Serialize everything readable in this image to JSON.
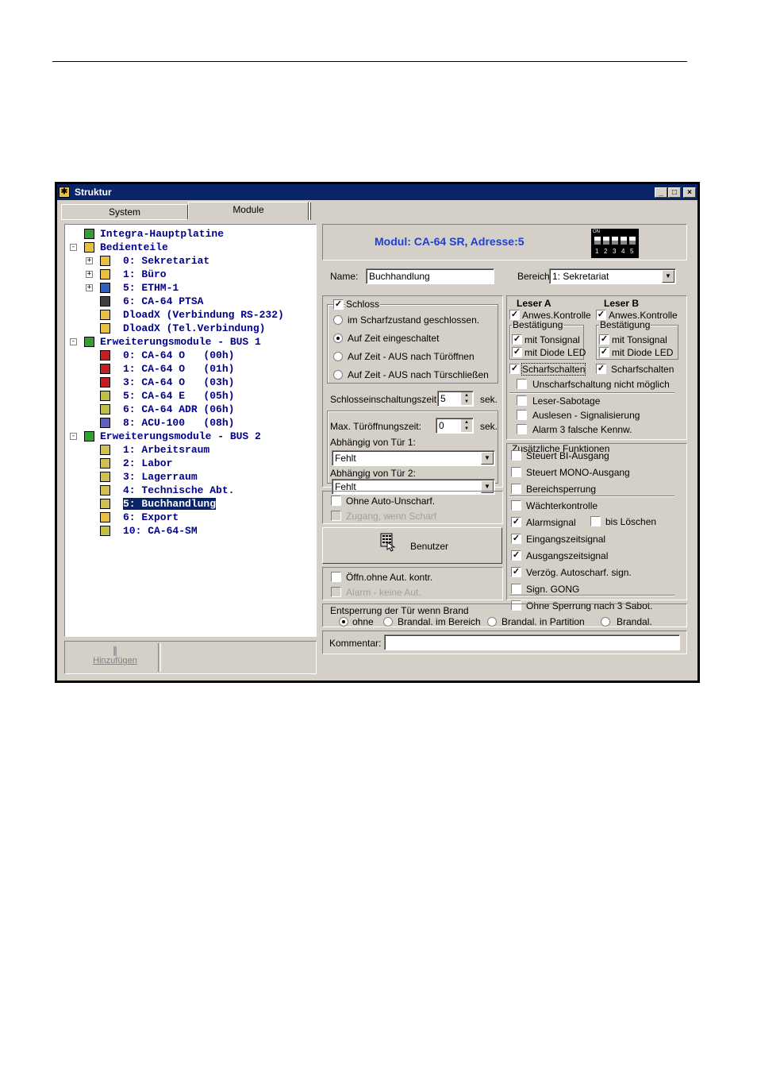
{
  "window": {
    "title": "Struktur",
    "controls": {
      "minimize": "_",
      "maximize": "□",
      "close": "×"
    }
  },
  "tabs": [
    {
      "label": "System",
      "active": false
    },
    {
      "label": "Module",
      "active": true
    }
  ],
  "tree": [
    {
      "label": "Integra-Hauptplatine",
      "icon": "board-icon",
      "expand": ""
    },
    {
      "label": "Bedienteile",
      "icon": "keypad-group-icon",
      "expand": "-"
    },
    {
      "label": "0: Sekretariat",
      "icon": "keypad-icon",
      "expand": "+"
    },
    {
      "label": "1: Büro",
      "icon": "keypad-icon",
      "expand": "+"
    },
    {
      "label": "5: ETHM-1",
      "icon": "ethernet-module-icon",
      "expand": "+"
    },
    {
      "label": "6: CA-64 PTSA",
      "icon": "ptsa-icon",
      "expand": ""
    },
    {
      "label": "DloadX (Verbindung RS-232)",
      "icon": "dloadx-icon",
      "expand": ""
    },
    {
      "label": "DloadX (Tel.Verbindung)",
      "icon": "dloadx-icon",
      "expand": ""
    },
    {
      "label": "Erweiterungsmodule - BUS 1",
      "icon": "bus-icon",
      "expand": "-"
    },
    {
      "label": "0: CA-64 O   (00h)",
      "icon": "output-module-icon",
      "expand": ""
    },
    {
      "label": "1: CA-64 O   (01h)",
      "icon": "output-module-icon",
      "expand": ""
    },
    {
      "label": "3: CA-64 O   (03h)",
      "icon": "output-module-icon",
      "expand": ""
    },
    {
      "label": "5: CA-64 E   (05h)",
      "icon": "expander-icon",
      "expand": ""
    },
    {
      "label": "6: CA-64 ADR (06h)",
      "icon": "expander-icon",
      "expand": ""
    },
    {
      "label": "8: ACU-100   (08h)",
      "icon": "wireless-icon",
      "expand": ""
    },
    {
      "label": "Erweiterungsmodule - BUS 2",
      "icon": "bus-icon",
      "expand": "-"
    },
    {
      "label": "1: Arbeitsraum",
      "icon": "reader-icon",
      "expand": ""
    },
    {
      "label": "2: Labor",
      "icon": "key-reader-icon",
      "expand": ""
    },
    {
      "label": "3: Lagerraum",
      "icon": "reader-icon",
      "expand": ""
    },
    {
      "label": "4: Technische Abt.",
      "icon": "key-reader-icon",
      "expand": ""
    },
    {
      "label": "5: Buchhandlung",
      "icon": "card-reader-icon",
      "expand": "",
      "selected": true
    },
    {
      "label": "6: Export",
      "icon": "door-module-icon",
      "expand": ""
    },
    {
      "label": "10: CA-64-SM",
      "icon": "siren-icon",
      "expand": ""
    }
  ],
  "add_button": {
    "label": "Hinzufügen",
    "underline": "H"
  },
  "header": {
    "module_title": "Modul: CA-64 SR, Adresse:5",
    "dip_on": "ON",
    "dip_numbers": [
      "1",
      "2",
      "3",
      "4",
      "5"
    ],
    "accent": "#1f3fd0"
  },
  "form": {
    "name_label": "Name:",
    "name_value": "Buchhandlung",
    "bereich_label": "Bereich",
    "bereich_value": "1: Sekretariat",
    "schloss_label": "Schloss",
    "schloss_checked": true,
    "schloss_options": [
      {
        "label": "im Scharfzustand geschlossen.",
        "selected": false
      },
      {
        "label": "Auf Zeit eingeschaltet",
        "selected": true
      },
      {
        "label": "Auf Zeit - AUS nach Türöffnen",
        "selected": false
      },
      {
        "label": "Auf Zeit - AUS nach Türschließen",
        "selected": false
      }
    ],
    "schloss_time_label": "Schlosseinschaltungszeit:",
    "schloss_time_value": "5",
    "sek": "sek.",
    "max_open_label": "Max. Türöffnungszeit:",
    "max_open_value": "0",
    "depend1_label": "Abhängig von Tür 1:",
    "depend1_value": "Fehlt",
    "depend2_label": "Abhängig von Tür 2:",
    "depend2_value": "Fehlt",
    "ohne_auto_unscharf": {
      "label": "Ohne Auto-Unscharf.",
      "checked": false
    },
    "zugang_wenn_scharf": {
      "label": "Zugang, wenn Scharf",
      "checked": false,
      "disabled": true
    },
    "benutzer_label": "Benutzer",
    "offn_ohne": {
      "label": "Öffn.ohne Aut. kontr.",
      "checked": false
    },
    "alarm_keine_aut": {
      "label": "Alarm - keine Aut.",
      "checked": false,
      "disabled": true
    },
    "brand_label": "Entsperrung der Tür wenn Brand",
    "brand_options": [
      {
        "label": "ohne",
        "selected": true
      },
      {
        "label": "Brandal. im Bereich",
        "selected": false
      },
      {
        "label": "Brandal. in Partition",
        "selected": false
      },
      {
        "label": "Brandal.",
        "selected": false
      }
    ],
    "kommentar_label": "Kommentar:",
    "kommentar_value": ""
  },
  "leser": {
    "a_title": "Leser A",
    "b_title": "Leser B",
    "a_anwes": {
      "label": "Anwes.Kontrolle",
      "checked": true
    },
    "b_anwes": {
      "label": "Anwes.Kontrolle",
      "checked": true
    },
    "bestaetigung": "Bestätigung",
    "a_tonsignal": {
      "label": "mit Tonsignal",
      "checked": true
    },
    "a_diode": {
      "label": "mit Diode LED",
      "checked": true
    },
    "b_tonsignal": {
      "label": "mit Tonsignal",
      "checked": true
    },
    "b_diode": {
      "label": "mit Diode LED",
      "checked": true
    },
    "a_scharf": {
      "label": "Scharfschalten",
      "checked": true
    },
    "b_scharf": {
      "label": "Scharfschalten",
      "checked": true
    },
    "unscharf_nicht": {
      "label": "Unscharfschaltung nicht möglich",
      "checked": false
    },
    "leser_sabotage": {
      "label": "Leser-Sabotage",
      "checked": false
    },
    "auslesen": {
      "label": "Auslesen - Signalisierung",
      "checked": false
    },
    "alarm3": {
      "label": "Alarm 3 falsche Kennw.",
      "checked": false
    }
  },
  "zusatz": {
    "title": "Zusätzliche Funktionen",
    "items": [
      {
        "label": "Steuert BI-Ausgang",
        "checked": false
      },
      {
        "label": "Steuert MONO-Ausgang",
        "checked": false
      },
      {
        "label": "Bereichsperrung",
        "checked": false
      },
      {
        "label": "Wächterkontrolle",
        "checked": false
      },
      {
        "label": "Alarmsignal",
        "checked": true
      },
      {
        "label": "Eingangszeitsignal",
        "checked": true
      },
      {
        "label": "Ausgangszeitsignal",
        "checked": true
      },
      {
        "label": "Verzög. Autoscharf. sign.",
        "checked": true
      },
      {
        "label": "Sign. GONG",
        "checked": false
      },
      {
        "label": "Ohne Sperrung nach 3 Sabot.",
        "checked": false
      }
    ],
    "bis_loeschen": {
      "label": "bis Löschen",
      "checked": false
    }
  }
}
